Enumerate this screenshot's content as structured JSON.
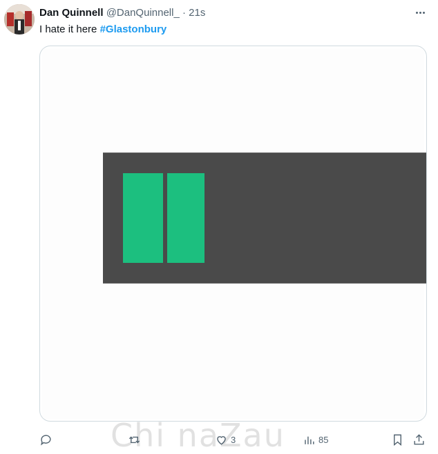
{
  "tweet": {
    "author_name": "Dan Quinnell",
    "handle": "@DanQuinnell_",
    "separator": "·",
    "time": "21s",
    "text": "I hate it here",
    "hashtag": "#Glastonbury"
  },
  "media": {
    "description_colors": {
      "battery_body": "#4a4a4a",
      "battery_cells": "#1cbf7f"
    },
    "charge_cells_filled": 2
  },
  "actions": {
    "reply_icon": "reply-icon",
    "retweet_icon": "retweet-icon",
    "like_icon": "heart-icon",
    "like_count": "3",
    "views_icon": "views-icon",
    "views_count": "85",
    "bookmark_icon": "bookmark-icon",
    "share_icon": "share-icon"
  },
  "watermark": "Chi naZau",
  "colors": {
    "hashtag": "#1d9bf0",
    "secondary_text": "#536471"
  }
}
